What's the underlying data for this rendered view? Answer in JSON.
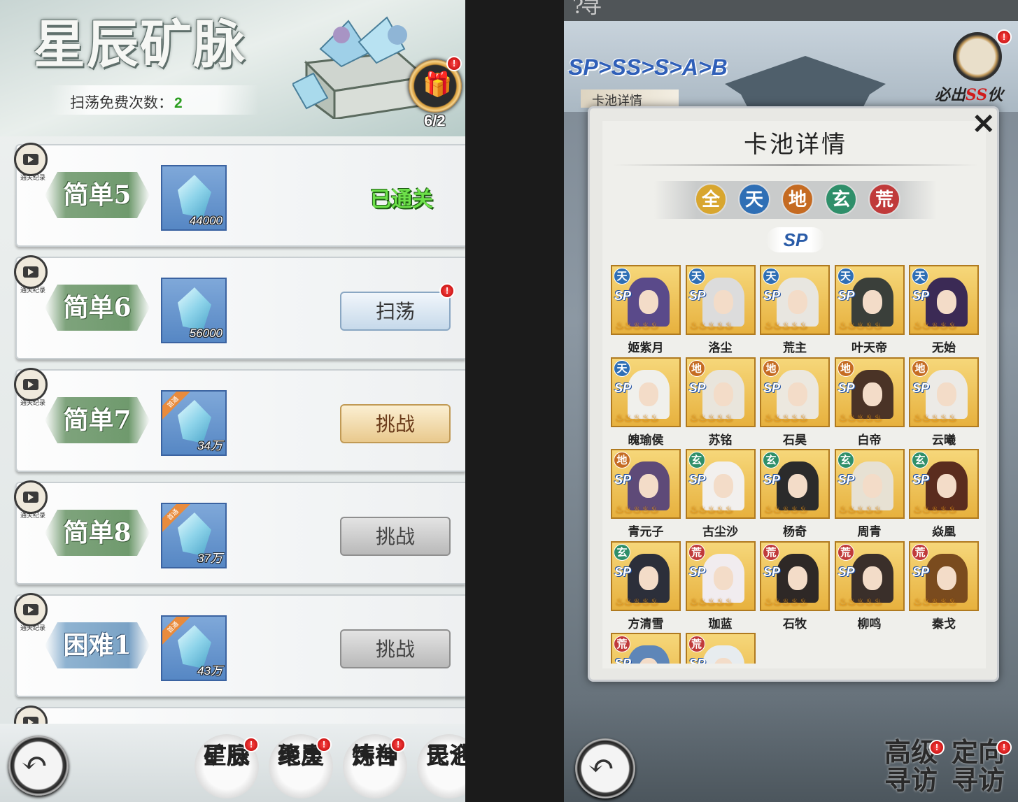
{
  "left": {
    "title": "星辰矿脉",
    "sweep_label": "扫荡免费次数：",
    "sweep_count": "2",
    "chest_count": "6/2",
    "record_label": "通关纪录",
    "rows": [
      {
        "level": "简单5",
        "reward": "44000",
        "status": "已通关",
        "type": "cleared",
        "hard": false,
        "ribbon": ""
      },
      {
        "level": "简单6",
        "reward": "56000",
        "status": "扫荡",
        "type": "sweep",
        "hard": false,
        "ribbon": ""
      },
      {
        "level": "简单7",
        "reward": "34万",
        "status": "挑战",
        "type": "challenge",
        "hard": false,
        "ribbon": "首通"
      },
      {
        "level": "简单8",
        "reward": "37万",
        "status": "挑战",
        "type": "locked",
        "hard": false,
        "ribbon": "首通"
      },
      {
        "level": "困难1",
        "reward": "43万",
        "status": "挑战",
        "type": "locked",
        "hard": true,
        "ribbon": "首通"
      }
    ],
    "nav": [
      {
        "line1": "星辰",
        "line2": "矿脉"
      },
      {
        "line1": "聚灵",
        "line2": "绝崖"
      },
      {
        "line1": "炼神",
        "line2": "铸台"
      },
      {
        "line1": "昆仑",
        "line2": "天池"
      }
    ]
  },
  "right": {
    "top_title": "寻仙楼",
    "ranks": "SP>SS>S>A>B",
    "pool_tab": "卡池详情",
    "must_text": "必出",
    "must_rank": "SS",
    "must_suffix": "伙伴",
    "dialog_title": "卡池详情",
    "close_glyph": "✕",
    "filters": [
      {
        "label": "全",
        "color": "#d8a62f"
      },
      {
        "label": "天",
        "color": "#2f6fb5"
      },
      {
        "label": "地",
        "color": "#c56b22"
      },
      {
        "label": "玄",
        "color": "#2f8f6a"
      },
      {
        "label": "荒",
        "color": "#c03a3a"
      }
    ],
    "sp_label": "SP",
    "grade": "SP",
    "flames": "♨♨♨♨♨",
    "cards": [
      {
        "name": "姬紫月",
        "elem": "天",
        "ec": "#2f6fb5",
        "hair": "#5a4a8a"
      },
      {
        "name": "洛尘",
        "elem": "天",
        "ec": "#2f6fb5",
        "hair": "#dcdcdc"
      },
      {
        "name": "荒主",
        "elem": "天",
        "ec": "#2f6fb5",
        "hair": "#e8e6e0"
      },
      {
        "name": "叶天帝",
        "elem": "天",
        "ec": "#2f6fb5",
        "hair": "#3a3f3a"
      },
      {
        "name": "无始",
        "elem": "天",
        "ec": "#2f6fb5",
        "hair": "#3b2a55"
      },
      {
        "name": "魄瑜侯",
        "elem": "天",
        "ec": "#2f6fb5",
        "hair": "#f0f0ec"
      },
      {
        "name": "苏铭",
        "elem": "地",
        "ec": "#c56b22",
        "hair": "#e9e5dc"
      },
      {
        "name": "石昊",
        "elem": "地",
        "ec": "#c56b22",
        "hair": "#ece8df"
      },
      {
        "name": "白帝",
        "elem": "地",
        "ec": "#c56b22",
        "hair": "#4a3326"
      },
      {
        "name": "云曦",
        "elem": "地",
        "ec": "#c56b22",
        "hair": "#eceae6"
      },
      {
        "name": "青元子",
        "elem": "地",
        "ec": "#c56b22",
        "hair": "#5e4a78"
      },
      {
        "name": "古尘沙",
        "elem": "玄",
        "ec": "#2f8f6a",
        "hair": "#f2f0ee"
      },
      {
        "name": "杨奇",
        "elem": "玄",
        "ec": "#2f8f6a",
        "hair": "#2b2b2b"
      },
      {
        "name": "周青",
        "elem": "玄",
        "ec": "#2f8f6a",
        "hair": "#e7e1d3"
      },
      {
        "name": "焱凰",
        "elem": "玄",
        "ec": "#2f8f6a",
        "hair": "#5a2c1e"
      },
      {
        "name": "方清雪",
        "elem": "玄",
        "ec": "#2f8f6a",
        "hair": "#2c2f3a"
      },
      {
        "name": "珈蓝",
        "elem": "荒",
        "ec": "#c03a3a",
        "hair": "#f1ecef"
      },
      {
        "name": "石牧",
        "elem": "荒",
        "ec": "#c03a3a",
        "hair": "#2e2826"
      },
      {
        "name": "柳鸣",
        "elem": "荒",
        "ec": "#c03a3a",
        "hair": "#3a2f2a"
      },
      {
        "name": "秦戈",
        "elem": "荒",
        "ec": "#c03a3a",
        "hair": "#7a4b1e"
      },
      {
        "name": "",
        "elem": "荒",
        "ec": "#c03a3a",
        "hair": "#5e86b8"
      },
      {
        "name": "",
        "elem": "荒",
        "ec": "#c03a3a",
        "hair": "#e7ecef"
      }
    ],
    "nav": [
      {
        "line1": "高级",
        "line2": "寻访"
      },
      {
        "line1": "定向",
        "line2": "寻访"
      }
    ]
  }
}
